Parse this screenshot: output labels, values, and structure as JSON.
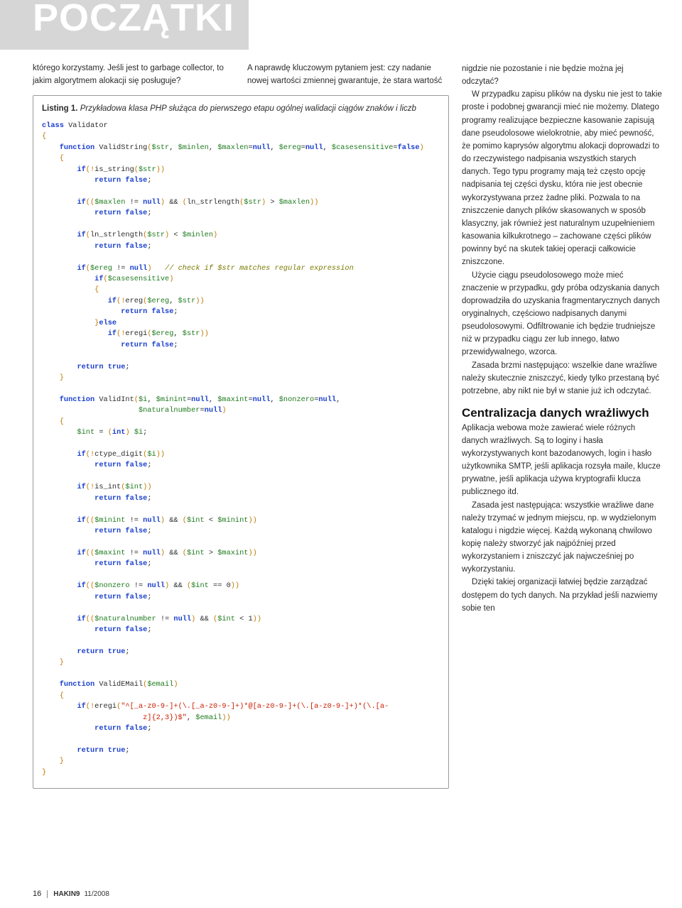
{
  "banner": {
    "title": "POCZĄTKI"
  },
  "intro": {
    "left": "którego korzystamy. Jeśli jest to garbage collector, to jakim algorytmem alokacji się posługuje?",
    "right": "A naprawdę kluczowym pytaniem jest: czy nadanie nowej wartości zmiennej gwarantuje, że stara wartość"
  },
  "listing": {
    "label": "Listing 1.",
    "caption": "Przykładowa klasa PHP służąca do pierwszego etapu ogólnej walidacji ciągów znaków i liczb"
  },
  "code": {
    "l1": "class",
    "l1b": " Validator",
    "l2": "{",
    "l3a": "    ",
    "l3b": "function",
    "l3c": " ValidString",
    "l3d": "(",
    "l3e": "$str",
    "l3f": ", ",
    "l3g": "$minlen",
    "l3h": ", ",
    "l3i": "$maxlen",
    "l3j": "=",
    "l3k": "null",
    "l3l": ", ",
    "l3m": "$ereg",
    "l3n": "=",
    "l3o": "null",
    "l3p": ", ",
    "l3q": "$casesensitive",
    "l3r": "=",
    "l3s": "false",
    "l3t": ")",
    "l4": "    {",
    "l5a": "        ",
    "l5b": "if",
    "l5c": "(!",
    "l5d": "is_string",
    "l5e": "(",
    "l5f": "$str",
    "l5g": "))",
    "l6a": "            ",
    "l6b": "return",
    "l6c": " ",
    "l6d": "false",
    "l6e": ";",
    "blank": "",
    "l7a": "        ",
    "l7b": "if",
    "l7c": "((",
    "l7d": "$maxlen",
    "l7e": " != ",
    "l7f": "null",
    "l7g": ")",
    "l7h": " && ",
    "l7i": "(",
    "l7j": "ln_strlength",
    "l7k": "(",
    "l7l": "$str",
    "l7m": ")",
    "l7n": " > ",
    "l7o": "$maxlen",
    "l7p": "))",
    "l8a": "            ",
    "l8b": "return",
    "l8c": " ",
    "l8d": "false",
    "l8e": ";",
    "l9a": "        ",
    "l9b": "if",
    "l9c": "(",
    "l9d": "ln_strlength",
    "l9e": "(",
    "l9f": "$str",
    "l9g": ")",
    "l9h": " < ",
    "l9i": "$minlen",
    "l9j": ")",
    "l10a": "            ",
    "l10b": "return",
    "l10c": " ",
    "l10d": "false",
    "l10e": ";",
    "l11a": "        ",
    "l11b": "if",
    "l11c": "(",
    "l11d": "$ereg",
    "l11e": " != ",
    "l11f": "null",
    "l11g": ")",
    "l11h": "   ",
    "l11i": "// check if $str matches regular expression",
    "l12a": "            ",
    "l12b": "if",
    "l12c": "(",
    "l12d": "$casesensitive",
    "l12e": ")",
    "l13": "            {",
    "l14a": "               ",
    "l14b": "if",
    "l14c": "(!",
    "l14d": "ereg",
    "l14e": "(",
    "l14f": "$ereg",
    "l14g": ", ",
    "l14h": "$str",
    "l14i": "))",
    "l15a": "                  ",
    "l15b": "return",
    "l15c": " ",
    "l15d": "false",
    "l15e": ";",
    "l16a": "            }",
    "l16b": "else",
    "l17a": "               ",
    "l17b": "if",
    "l17c": "(!",
    "l17d": "eregi",
    "l17e": "(",
    "l17f": "$ereg",
    "l17g": ", ",
    "l17h": "$str",
    "l17i": "))",
    "l18a": "                  ",
    "l18b": "return",
    "l18c": " ",
    "l18d": "false",
    "l18e": ";",
    "l19a": "        ",
    "l19b": "return",
    "l19c": " ",
    "l19d": "true",
    "l19e": ";",
    "l20": "    }",
    "l21a": "    ",
    "l21b": "function",
    "l21c": " ValidInt",
    "l21d": "(",
    "l21e": "$i",
    "l21f": ", ",
    "l21g": "$minint",
    "l21h": "=",
    "l21i": "null",
    "l21j": ", ",
    "l21k": "$maxint",
    "l21l": "=",
    "l21m": "null",
    "l21n": ", ",
    "l21o": "$nonzero",
    "l21p": "=",
    "l21q": "null",
    "l21r": ",",
    "l21s": "                      ",
    "l21t": "$naturalnumber",
    "l21u": "=",
    "l21v": "null",
    "l21w": ")",
    "l22": "    {",
    "l23a": "        ",
    "l23b": "$int",
    "l23c": " = ",
    "l23d": "(",
    "l23e": "int",
    "l23f": ")",
    "l23g": " ",
    "l23h": "$i",
    "l23i": ";",
    "l24a": "        ",
    "l24b": "if",
    "l24c": "(!",
    "l24d": "ctype_digit",
    "l24e": "(",
    "l24f": "$i",
    "l24g": "))",
    "l25a": "            ",
    "l25b": "return",
    "l25c": " ",
    "l25d": "false",
    "l25e": ";",
    "l26a": "        ",
    "l26b": "if",
    "l26c": "(!",
    "l26d": "is_int",
    "l26e": "(",
    "l26f": "$int",
    "l26g": "))",
    "l27a": "            ",
    "l27b": "return",
    "l27c": " ",
    "l27d": "false",
    "l27e": ";",
    "l28a": "        ",
    "l28b": "if",
    "l28c": "((",
    "l28d": "$minint",
    "l28e": " != ",
    "l28f": "null",
    "l28g": ")",
    "l28h": " && ",
    "l28i": "(",
    "l28j": "$int",
    "l28k": " < ",
    "l28l": "$minint",
    "l28m": "))",
    "l29a": "            ",
    "l29b": "return",
    "l29c": " ",
    "l29d": "false",
    "l29e": ";",
    "l30a": "        ",
    "l30b": "if",
    "l30c": "((",
    "l30d": "$maxint",
    "l30e": " != ",
    "l30f": "null",
    "l30g": ")",
    "l30h": " && ",
    "l30i": "(",
    "l30j": "$int",
    "l30k": " > ",
    "l30l": "$maxint",
    "l30m": "))",
    "l31a": "            ",
    "l31b": "return",
    "l31c": " ",
    "l31d": "false",
    "l31e": ";",
    "l32a": "        ",
    "l32b": "if",
    "l32c": "((",
    "l32d": "$nonzero",
    "l32e": " != ",
    "l32f": "null",
    "l32g": ")",
    "l32h": " && ",
    "l32i": "(",
    "l32j": "$int",
    "l32k": " == ",
    "l32l": "0",
    "l32m": "))",
    "l33a": "            ",
    "l33b": "return",
    "l33c": " ",
    "l33d": "false",
    "l33e": ";",
    "l34a": "        ",
    "l34b": "if",
    "l34c": "((",
    "l34d": "$naturalnumber",
    "l34e": " != ",
    "l34f": "null",
    "l34g": ")",
    "l34h": " && ",
    "l34i": "(",
    "l34j": "$int",
    "l34k": " < ",
    "l34l": "1",
    "l34m": "))",
    "l35a": "            ",
    "l35b": "return",
    "l35c": " ",
    "l35d": "false",
    "l35e": ";",
    "l36a": "        ",
    "l36b": "return",
    "l36c": " ",
    "l36d": "true",
    "l36e": ";",
    "l37": "    }",
    "l38a": "    ",
    "l38b": "function",
    "l38c": " ValidEMail",
    "l38d": "(",
    "l38e": "$email",
    "l38f": ")",
    "l39": "    {",
    "l40a": "        ",
    "l40b": "if",
    "l40c": "(!",
    "l40d": "eregi",
    "l40e": "(",
    "l40f": "\"^[_a-z0-9-]+(\\.[_a-z0-9-]+)*@[a-z0-9-]+(\\.[a-z0-9-]+)*(\\.[a-",
    "l40g": "                       z]{2,3})$\"",
    "l40h": ", ",
    "l40i": "$email",
    "l40j": "))",
    "l41a": "            ",
    "l41b": "return",
    "l41c": " ",
    "l41d": "false",
    "l41e": ";",
    "l42a": "        ",
    "l42b": "return",
    "l42c": " ",
    "l42d": "true",
    "l42e": ";",
    "l43": "    }",
    "l44": "}"
  },
  "right": {
    "p1": "nigdzie nie pozostanie i nie będzie można jej odczytać?",
    "p2": "W przypadku zapisu plików na dysku nie jest to takie proste i podobnej gwarancji mieć nie możemy. Dlatego programy realizujące bezpieczne kasowanie zapisują dane pseudolosowe wielokrotnie, aby mieć pewność, że pomimo kaprysów algorytmu alokacji doprowadzi to do rzeczywistego nadpisania wszystkich starych danych. Tego typu programy mają też często opcję nadpisania tej części dysku, która nie jest obecnie wykorzystywana przez żadne pliki. Pozwala to na zniszczenie danych plików skasowanych w sposób klasyczny, jak również jest naturalnym uzupełnieniem kasowania kilkukrotnego – zachowane części plików powinny być na skutek takiej operacji całkowicie zniszczone.",
    "p3": "Użycie ciągu pseudolosowego może mieć znaczenie w przypadku, gdy próba odzyskania danych doprowadziła do uzyskania fragmentarycznych danych oryginalnych, częściowo nadpisanych danymi pseudolosowymi. Odfiltrowanie ich będzie trudniejsze niż w przypadku ciągu zer lub innego, łatwo przewidywalnego, wzorca.",
    "p4": "Zasada brzmi następująco: wszelkie dane wrażliwe należy skutecznie zniszczyć, kiedy tylko przestaną być potrzebne, aby nikt nie był w stanie już ich odczytać.",
    "h1": "Centralizacja danych wrażliwych",
    "p5": "Aplikacja webowa może zawierać wiele różnych danych wrażliwych. Są to loginy i hasła wykorzystywanych kont bazodanowych, login i hasło użytkownika SMTP, jeśli aplikacja rozsyła maile, klucze prywatne, jeśli aplikacja używa kryptografii klucza publicznego itd.",
    "p6": "Zasada jest następująca: wszystkie wrażliwe dane należy trzymać w jednym miejscu, np. w wydzielonym katalogu i nigdzie więcej. Każdą wykonaną chwilowo kopię należy stworzyć jak najpóźniej przed wykorzystaniem i zniszczyć jak najwcześniej po wykorzystaniu.",
    "p7": "Dzięki takiej organizacji łatwiej będzie zarządzać dostępem do tych danych. Na przykład jeśli nazwiemy sobie ten"
  },
  "footer": {
    "page": "16",
    "mag": "HAKIN9",
    "issue": "11/2008"
  }
}
